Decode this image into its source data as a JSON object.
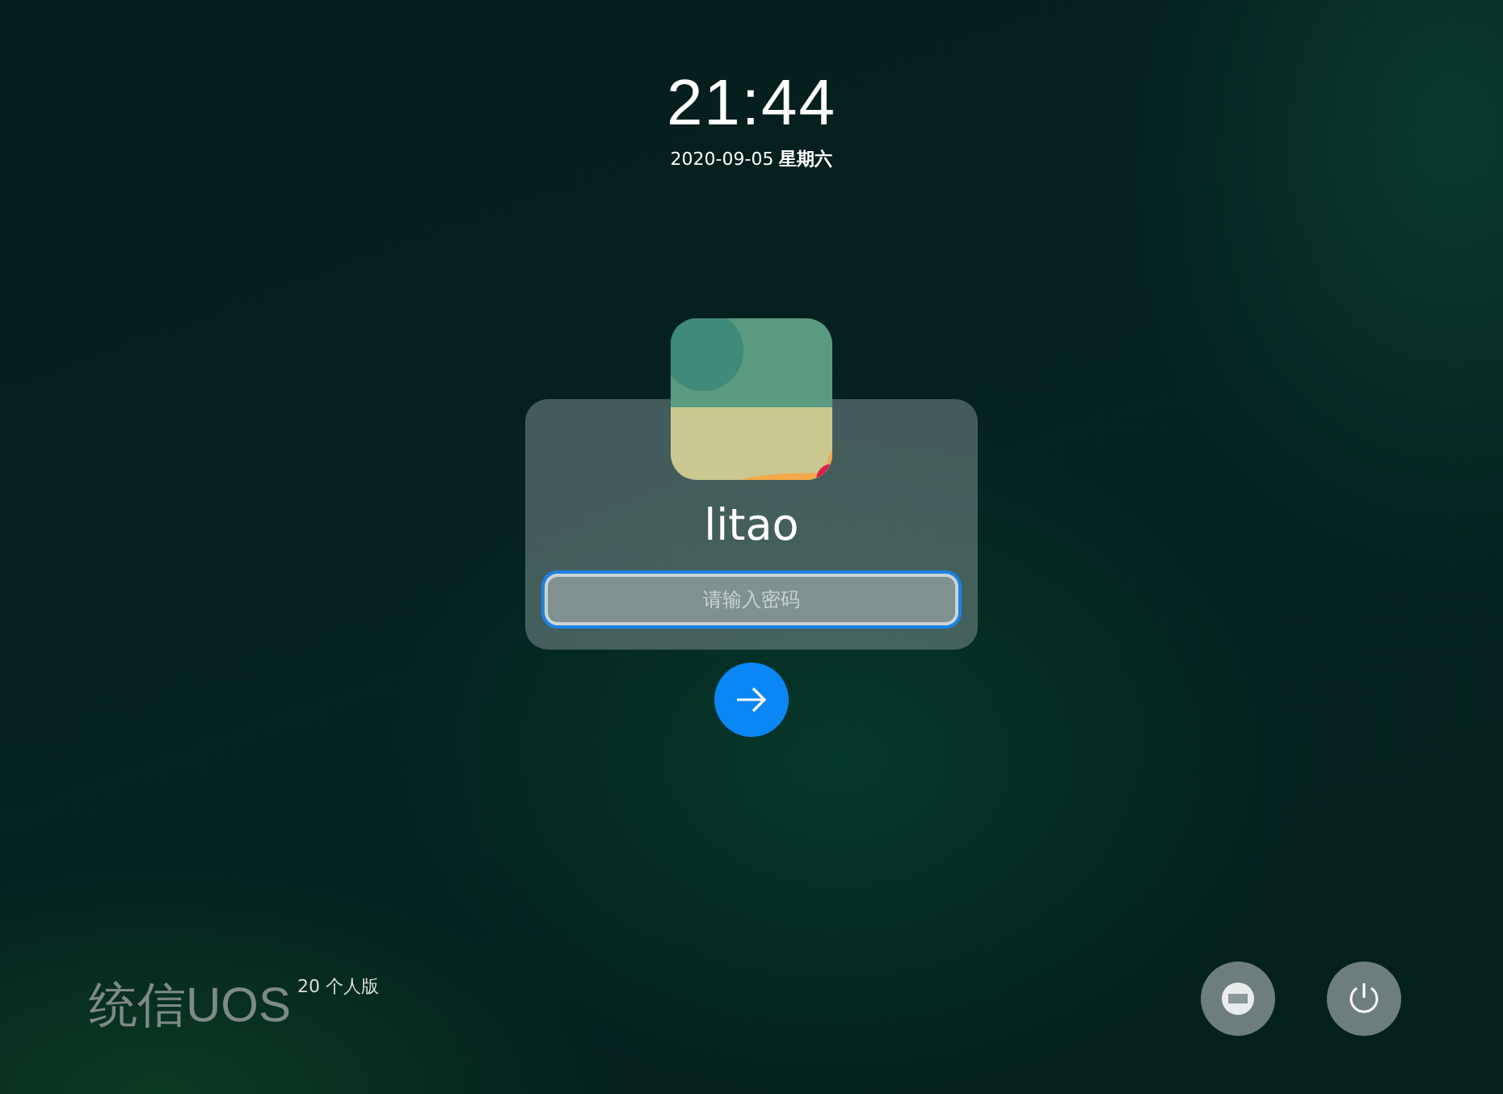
{
  "clock": {
    "time": "21:44",
    "date": "2020-09-05",
    "weekday": "星期六"
  },
  "login": {
    "username": "litao",
    "password": {
      "placeholder": "请输入密码",
      "focused": true
    }
  },
  "branding": {
    "logo": "统信UOS",
    "edition": "20 个人版"
  },
  "actions": [
    {
      "kind": "keyboard"
    },
    {
      "kind": "power"
    }
  ]
}
